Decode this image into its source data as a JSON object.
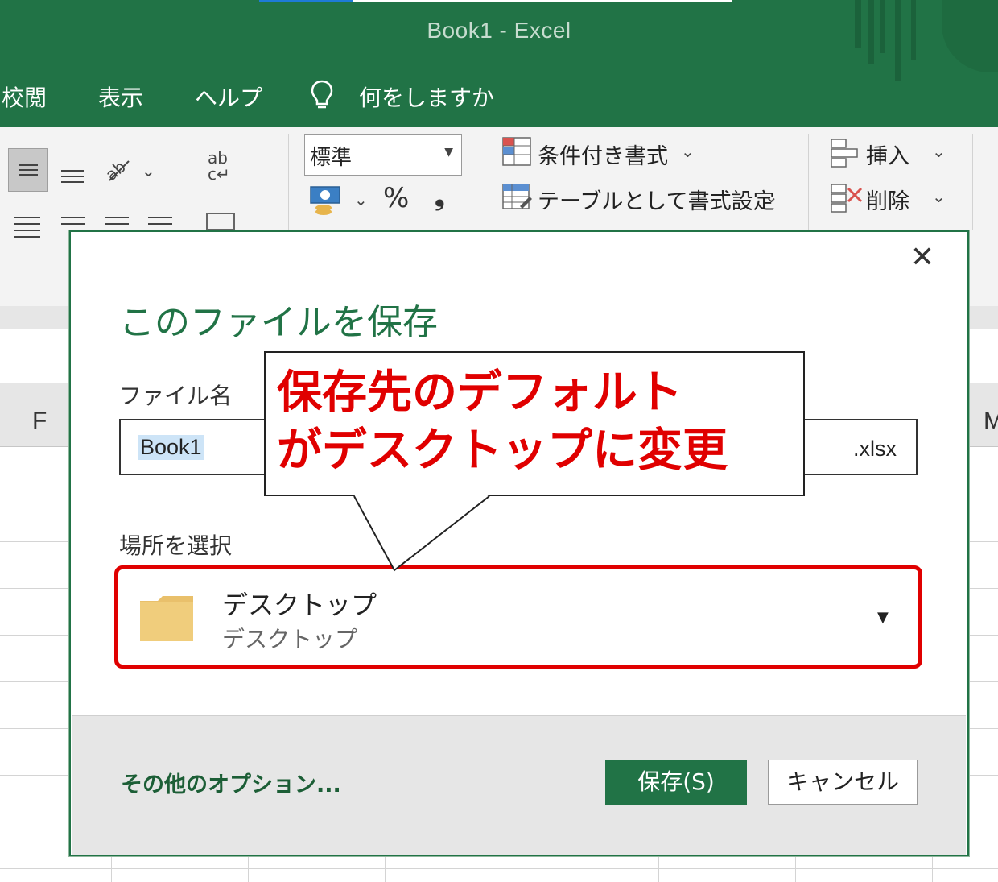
{
  "window": {
    "title": "Book1  -  Excel"
  },
  "ribbon_tabs": [
    "校閲",
    "表示",
    "ヘルプ"
  ],
  "tell_me": {
    "label": "何をしますか",
    "icon": "lightbulb-icon"
  },
  "ribbon": {
    "number_format": "標準",
    "percent_symbol": "%",
    "comma_symbol": "❟",
    "conditional_format": "条件付き書式",
    "format_as_table": "テーブルとして書式設定",
    "insert": "挿入",
    "delete": "削除",
    "wrap_glyph": "ab\nc↵"
  },
  "sheet": {
    "column_f": "F",
    "column_m": "M"
  },
  "dialog": {
    "title": "このファイルを保存",
    "filename_label": "ファイル名",
    "filename_value": "Book1",
    "extension": ".xlsx",
    "location_label": "場所を選択",
    "location_primary": "デスクトップ",
    "location_secondary": "デスクトップ",
    "more_options": "その他のオプション...",
    "save_label": "保存(S)",
    "cancel_label": "キャンセル",
    "close_glyph": "✕"
  },
  "callout": {
    "line1": "保存先のデフォルト",
    "line2": "がデスクトップに変更"
  },
  "colors": {
    "excel_green": "#217346",
    "highlight_red": "#e00000",
    "folder_yellow": "#f0cd7c"
  }
}
